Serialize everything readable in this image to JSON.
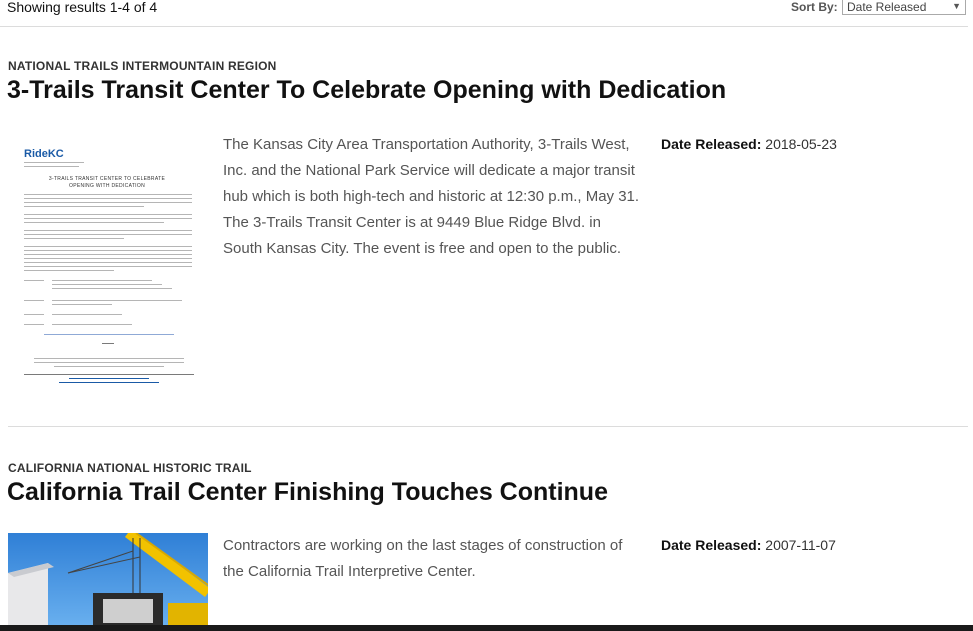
{
  "results": {
    "text": "Showing results 1-4 of 4"
  },
  "sort": {
    "label": "Sort By:",
    "selected": "Date Released"
  },
  "articles": [
    {
      "kicker": "NATIONAL TRAILS INTERMOUNTAIN REGION",
      "title": "3-Trails Transit Center To Celebrate Opening with Dedication",
      "summary": "The Kansas City Area Transportation Authority, 3-Trails West, Inc. and the National Park Service will dedicate a major transit hub which is both high-tech and historic at 12:30 p.m., May 31. The 3-Trails Transit Center is at 9449 Blue Ridge Blvd. in South Kansas City. The event is free and open to the public.",
      "date_label": "Date Released:",
      "date_value": "2018-05-23",
      "thumb": {
        "logo": "RideKC",
        "doc_title": "3-TRAILS TRANSIT CENTER TO CELEBRATE OPENING WITH DEDICATION"
      }
    },
    {
      "kicker": "CALIFORNIA NATIONAL HISTORIC TRAIL",
      "title": "California Trail Center Finishing Touches Continue",
      "summary": "Contractors are working on the last stages of construction of the California Trail Interpretive Center.",
      "date_label": "Date Released:",
      "date_value": "2007-11-07"
    }
  ]
}
